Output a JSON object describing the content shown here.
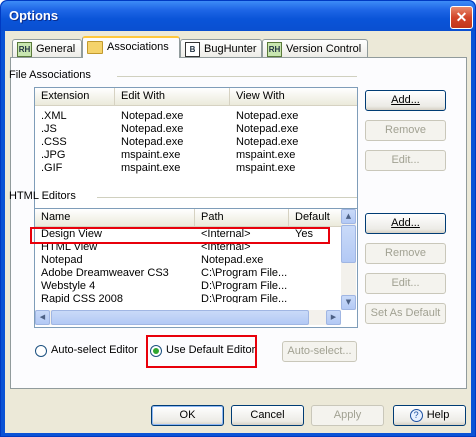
{
  "window": {
    "title": "Options",
    "close_glyph": "✕"
  },
  "tabs": [
    {
      "label": "General",
      "icon": "rh-icon"
    },
    {
      "label": "Associations",
      "icon": "folder-icon"
    },
    {
      "label": "BugHunter",
      "icon": "bughunter-icon"
    },
    {
      "label": "Version Control",
      "icon": "rh-icon"
    }
  ],
  "file_assoc": {
    "group_label": "File Associations",
    "columns": [
      "Extension",
      "Edit With",
      "View With"
    ],
    "rows": [
      [
        ".XML",
        "Notepad.exe",
        "Notepad.exe"
      ],
      [
        ".JS",
        "Notepad.exe",
        "Notepad.exe"
      ],
      [
        ".CSS",
        "Notepad.exe",
        "Notepad.exe"
      ],
      [
        ".JPG",
        "mspaint.exe",
        "mspaint.exe"
      ],
      [
        ".GIF",
        "mspaint.exe",
        "mspaint.exe"
      ]
    ],
    "buttons": {
      "add": "Add...",
      "remove": "Remove",
      "edit": "Edit..."
    }
  },
  "html_editors": {
    "group_label": "HTML Editors",
    "columns": [
      "Name",
      "Path",
      "Default"
    ],
    "rows": [
      [
        "Design View",
        "<Internal>",
        "Yes"
      ],
      [
        "HTML View",
        "<Internal>",
        ""
      ],
      [
        "Notepad",
        "Notepad.exe",
        ""
      ],
      [
        "Adobe Dreamweaver CS3",
        "C:\\Program File...",
        ""
      ],
      [
        "Webstyle 4",
        "D:\\Program File...",
        ""
      ],
      [
        "Rapid CSS 2008",
        "D:\\Program File...",
        ""
      ]
    ],
    "buttons": {
      "add": "Add...",
      "remove": "Remove",
      "edit": "Edit...",
      "set_default": "Set As Default"
    }
  },
  "editor_mode": {
    "auto_select": "Auto-select Editor",
    "use_default": "Use Default Editor",
    "selected": "use_default",
    "auto_select_button": "Auto-select..."
  },
  "footer": {
    "ok": "OK",
    "cancel": "Cancel",
    "apply": "Apply",
    "help": "Help"
  },
  "colors": {
    "titlebar": "#0a54d8",
    "highlight_box": "#e8000b",
    "selection_row": "#ffffff"
  }
}
